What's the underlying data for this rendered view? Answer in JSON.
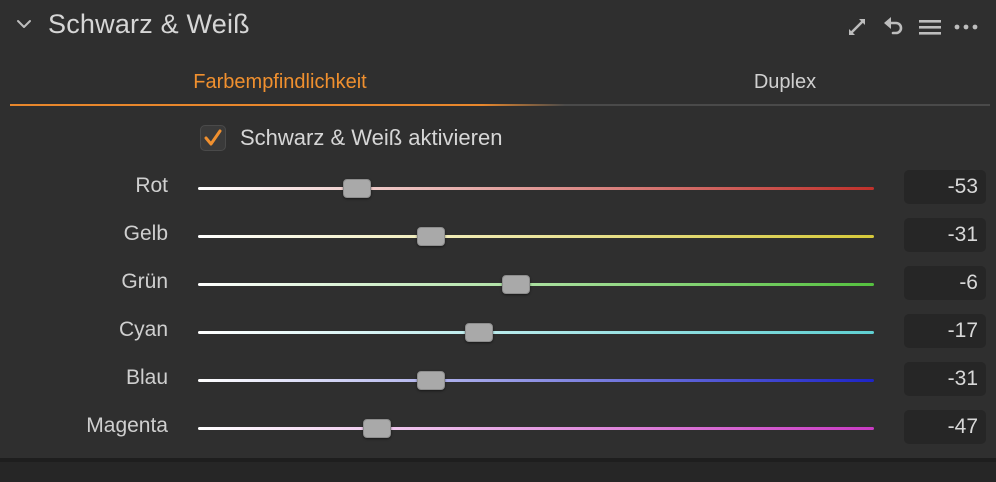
{
  "header": {
    "title": "Schwarz & Weiß",
    "icons": [
      "chevron-down-icon",
      "expand-icon",
      "reset-icon",
      "menu-icon",
      "more-icon"
    ]
  },
  "tabs": [
    {
      "label": "Farbempfindlichkeit",
      "active": true
    },
    {
      "label": "Duplex",
      "active": false
    }
  ],
  "enable": {
    "label": "Schwarz & Weiß aktivieren",
    "checked": true
  },
  "sliders": [
    {
      "label": "Rot",
      "value": "-53",
      "numeric": -53,
      "color": "#c0312b"
    },
    {
      "label": "Gelb",
      "value": "-31",
      "numeric": -31,
      "color": "#d6c93a"
    },
    {
      "label": "Grün",
      "value": "-6",
      "numeric": -6,
      "color": "#55c13f"
    },
    {
      "label": "Cyan",
      "value": "-17",
      "numeric": -17,
      "color": "#5fd0d2"
    },
    {
      "label": "Blau",
      "value": "-31",
      "numeric": -31,
      "color": "#1d24c7"
    },
    {
      "label": "Magenta",
      "value": "-47",
      "numeric": -47,
      "color": "#c93bc4"
    }
  ],
  "range": [
    -100,
    100
  ],
  "colors": {
    "accent": "#e8872c",
    "background": "#2f2f2f"
  }
}
